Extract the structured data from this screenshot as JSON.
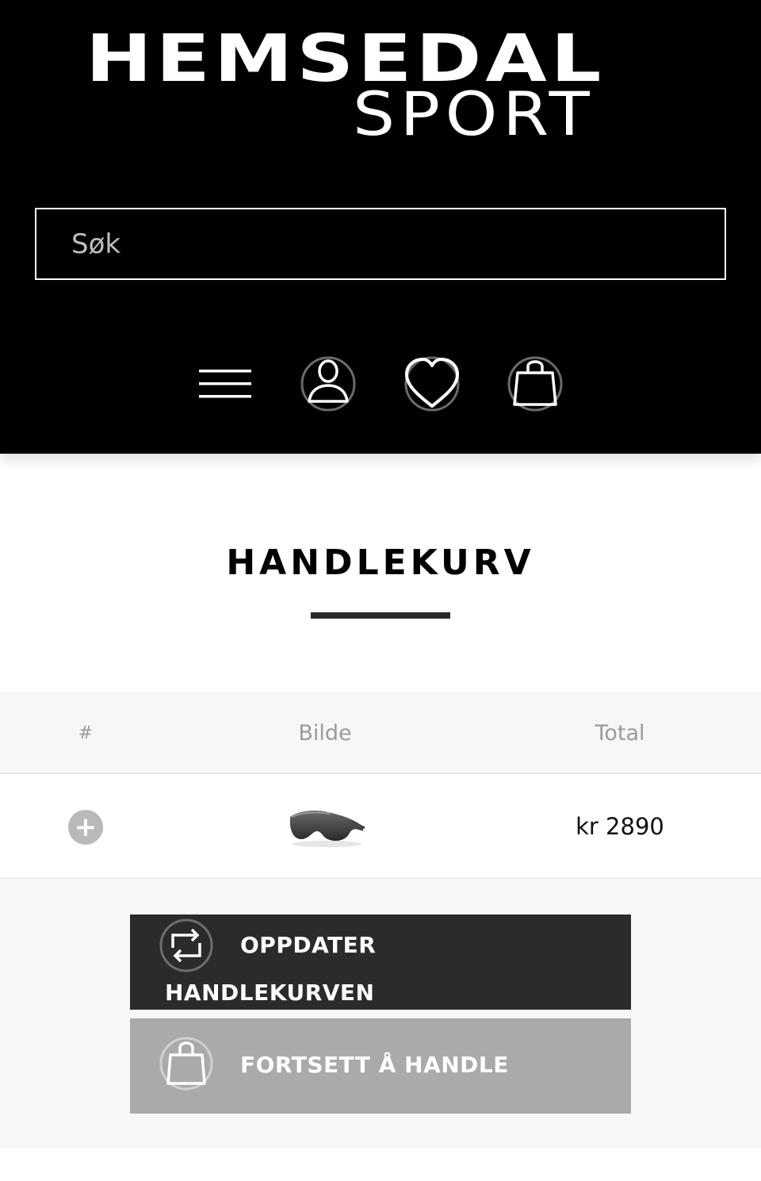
{
  "brand": {
    "logo_line1": "HEMSEDAL",
    "logo_line2": "SPORT"
  },
  "search": {
    "placeholder": "Søk"
  },
  "nav": {
    "icons": [
      "menu-icon",
      "user-icon",
      "heart-icon",
      "shopping-bag-icon"
    ]
  },
  "cart": {
    "title": "HANDLEKURV",
    "columns": [
      "#",
      "Bilde",
      "Total"
    ],
    "rows": [
      {
        "expand": "+",
        "image": "sunglasses-product-image",
        "total": "kr 2890"
      }
    ]
  },
  "actions": {
    "update_line1": "OPPDATER",
    "update_line2": "HANDLEKURVEN",
    "continue": "FORTSETT Å HANDLE"
  },
  "colors": {
    "header_bg": "#000000",
    "update_btn": "#2b2b2b",
    "continue_btn": "#aaaaaa"
  }
}
